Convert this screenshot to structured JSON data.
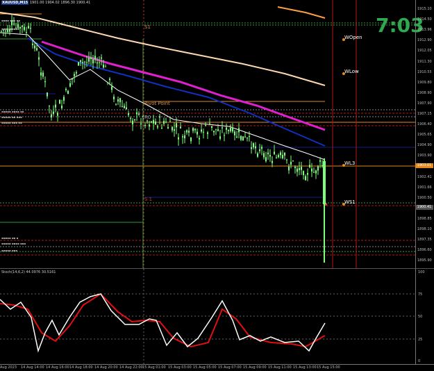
{
  "window": {
    "symbol": "XAUUSD,M15",
    "ohlc": "1901.00 1904.02 1896.30 1900.41"
  },
  "timer": "7:03",
  "price_axis": [
    "1915.10",
    "1914.50",
    "1913.96",
    "1912.90",
    "1912.05",
    "1911.30",
    "1910.55",
    "1909.80",
    "1908.90",
    "1907.90",
    "1907.15",
    "1906.40",
    "1905.65",
    "1904.90",
    "1903.90",
    "1903.16",
    "1902.41",
    "1901.66",
    "1900.50",
    "1899.60",
    "1898.85",
    "1898.10",
    "1897.35",
    "1896.60",
    "1895.90"
  ],
  "price_boxes": {
    "wl3": {
      "text": "1903.01",
      "color": "#e58a1f"
    },
    "current": {
      "text": "1900.41",
      "color": "#555555"
    }
  },
  "levels": {
    "wopen": "WOpen",
    "wlow": "WLow",
    "wl3": "WL3",
    "ws1": "WS1",
    "s1a": "S1",
    "s1b": "S 1",
    "pivot_point": "Pivot Point",
    "r0": "R0"
  },
  "osc_title": "Stoch(14,6,2) 44.0976 30.5161",
  "osc_axis": [
    "100",
    "75",
    "50",
    "25",
    "0"
  ],
  "time_axis": [
    "Aug 2023",
    "14 Aug 14:00",
    "14 Aug 16:00",
    "14 Aug 18:00",
    "14 Aug 20:00",
    "14 Aug 22:00",
    "15 Aug 01:00",
    "15 Aug 03:00",
    "15 Aug 05:00",
    "15 Aug 07:00",
    "15 Aug 09:00",
    "15 Aug 11:00",
    "15 Aug 13:00",
    "15 Aug 15:00"
  ],
  "colors": {
    "candle": "#7dff7d",
    "ma_fast": "#ffffff",
    "ma_magenta": "#e020d0",
    "ma_blue": "#1030c0",
    "ma_slow": "#ffd8b0",
    "ma_orange": "#ffa040",
    "stoch_main": "#ffffff",
    "stoch_signal": "#e01010",
    "level_orange": "#e58a1f",
    "level_red": "#b01818",
    "level_green": "#3a9a3a",
    "timer": "#2fa84f"
  }
}
